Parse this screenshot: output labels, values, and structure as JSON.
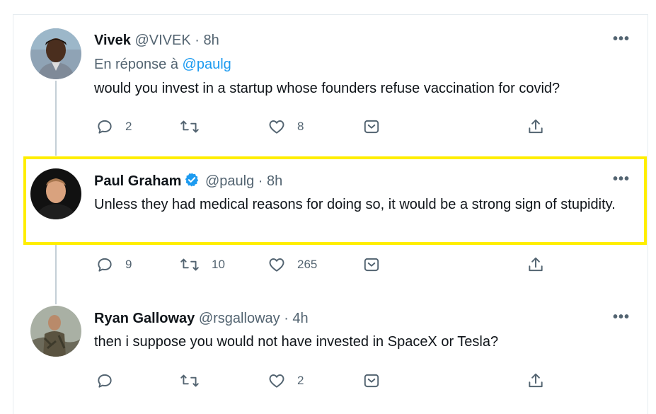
{
  "tweets": [
    {
      "name": "Vivek",
      "handle": "@VIVEK",
      "time": "· 8h",
      "reply_prefix": "En réponse à ",
      "reply_mention": "@paulg",
      "text": "would you invest in a startup whose founders refuse vaccination for covid?",
      "reply_count": "2",
      "retweet_count": "",
      "like_count": "8"
    },
    {
      "name": "Paul Graham",
      "verified": true,
      "handle": "@paulg",
      "time": "· 8h",
      "text": "Unless they had medical reasons for doing so, it would be a strong sign of stupidity.",
      "reply_count": "9",
      "retweet_count": "10",
      "like_count": "265"
    },
    {
      "name": "Ryan Galloway",
      "handle": "@rsgalloway",
      "time": "· 4h",
      "text": "then i suppose you would not have invested in SpaceX or Tesla?",
      "reply_count": "",
      "retweet_count": "",
      "like_count": "2"
    }
  ],
  "more_label": "•••",
  "colors": {
    "accent": "#1d9bf0",
    "highlight": "#ffee00",
    "muted": "#536471"
  },
  "icons": [
    "reply-icon",
    "retweet-icon",
    "like-icon",
    "save-icon",
    "share-icon",
    "more-icon",
    "verified-badge-icon"
  ]
}
